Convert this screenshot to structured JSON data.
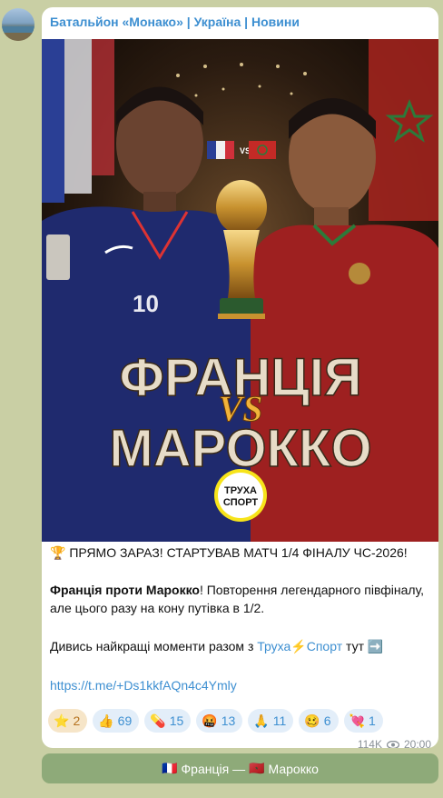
{
  "channel": {
    "name": "Батальйон «Монако» | Україна | Новини"
  },
  "poster": {
    "vs_badge": "VS",
    "title_line1": "ФРАНЦІЯ",
    "title_vs": "VS",
    "title_line2": "МАРОККО",
    "logo_line1": "ТРУХА",
    "logo_line2": "СПОРТ",
    "player_number": "10",
    "flag_left_icon": "flag-france-icon",
    "flag_right_icon": "flag-morocco-icon",
    "trophy_icon": "world-cup-trophy-icon"
  },
  "message": {
    "line1_emoji": "🏆",
    "line1": "ПРЯМО ЗАРАЗ! СТАРТУВАВ МАТЧ 1/4 ФІНАЛУ ЧС-2026!",
    "p2_bold": "Франція проти Марокко",
    "p2_rest": "! Повторення легендарного півфіналу, але цього разу на кону путівка в 1/2.",
    "p3_start": "Дивись найкращі моменти разом з ",
    "p3_link1": "Труха",
    "p3_bolt": "⚡",
    "p3_link2": "Спорт",
    "p3_end": " тут ",
    "p3_arrow": "➡️",
    "url": "https://t.me/+Ds1kkfAQn4c4Ymly"
  },
  "reactions": [
    {
      "emoji": "⭐",
      "count": "2"
    },
    {
      "emoji": "👍",
      "count": "69"
    },
    {
      "emoji": "💊",
      "count": "15"
    },
    {
      "emoji": "🤬",
      "count": "13"
    },
    {
      "emoji": "🙏",
      "count": "11"
    },
    {
      "emoji": "🥴",
      "count": "6"
    },
    {
      "emoji": "💘",
      "count": "1"
    }
  ],
  "meta": {
    "views": "114K",
    "time": "20:00",
    "views_icon": "eye-icon"
  },
  "button": {
    "flag_left": "🇫🇷",
    "label": "Франція — ",
    "flag_right": "🇲🇦",
    "label2": "Марокко"
  },
  "colors": {
    "accent": "#3d8fd1",
    "background": "#c9cfa4",
    "button": "#8eaa79"
  }
}
